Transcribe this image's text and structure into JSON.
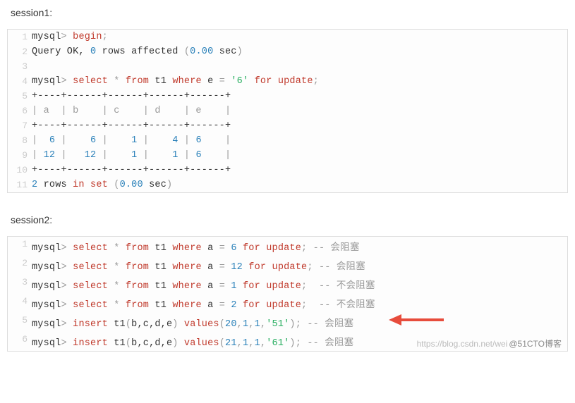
{
  "session1_label": "session1:",
  "session2_label": "session2:",
  "watermark1": "https://blog.csdn.net/wei",
  "watermark2": "@51CTO博客",
  "s1": {
    "l1": {
      "p1": "mysql",
      "p2": ">",
      "p3": " ",
      "p4": "begin",
      "p5": ";"
    },
    "l2": {
      "p1": "Query OK, ",
      "p2": "0",
      "p3": " rows affected ",
      "p4": "(",
      "p5": "0.00",
      "p6": " sec",
      "p7": ")"
    },
    "l4": {
      "p1": "mysql",
      "p2": ">",
      "p3": " ",
      "p4": "select",
      "p5": " ",
      "p6": "*",
      "p7": " ",
      "p8": "from",
      "p9": " t1 ",
      "p10": "where",
      "p11": " e ",
      "p12": "=",
      "p13": " ",
      "p14": "'6'",
      "p15": " ",
      "p16": "for",
      "p17": " ",
      "p18": "update",
      "p19": ";"
    },
    "l5": "+----+------+------+------+------+",
    "l6": "| a  | b    | c    | d    | e    |",
    "l7": "+----+------+------+------+------+",
    "l8": {
      "p0": "|  ",
      "a": "6",
      "p1": " |    ",
      "b": "6",
      "p2": " |    ",
      "c": "1",
      "p3": " |    ",
      "d": "4",
      "p4": " | ",
      "e": "6",
      "p5": "    |"
    },
    "l9": {
      "p0": "| ",
      "a": "12",
      "p1": " |   ",
      "b": "12",
      "p2": " |    ",
      "c": "1",
      "p3": " |    ",
      "d": "1",
      "p4": " | ",
      "e": "6",
      "p5": "    |"
    },
    "l10": "+----+------+------+------+------+",
    "l11": {
      "p1": "2",
      "p2": " rows ",
      "p3": "in",
      "p4": " ",
      "p5": "set",
      "p6": " ",
      "p7": "(",
      "p8": "0.00",
      "p9": " sec",
      "p10": ")"
    }
  },
  "s2": {
    "l1": {
      "p": "mysql",
      "gt": ">",
      "sp": " ",
      "sel": "select",
      "sp2": " ",
      "st": "*",
      "sp3": " ",
      "fr": "from",
      "sp4": " t1 ",
      "wh": "where",
      "sp5": " a ",
      "eq": "=",
      "sp6": " ",
      "n": "6",
      "sp7": " ",
      "fo": "for",
      "sp8": " ",
      "up": "update",
      "se": ";",
      "cm": " -- 会阻塞"
    },
    "l2": {
      "p": "mysql",
      "gt": ">",
      "sp": " ",
      "sel": "select",
      "sp2": " ",
      "st": "*",
      "sp3": " ",
      "fr": "from",
      "sp4": " t1 ",
      "wh": "where",
      "sp5": " a ",
      "eq": "=",
      "sp6": " ",
      "n": "12",
      "sp7": " ",
      "fo": "for",
      "sp8": " ",
      "up": "update",
      "se": ";",
      "cm": " -- 会阻塞"
    },
    "l3": {
      "p": "mysql",
      "gt": ">",
      "sp": " ",
      "sel": "select",
      "sp2": " ",
      "st": "*",
      "sp3": " ",
      "fr": "from",
      "sp4": " t1 ",
      "wh": "where",
      "sp5": " a ",
      "eq": "=",
      "sp6": " ",
      "n": "1",
      "sp7": " ",
      "fo": "for",
      "sp8": " ",
      "up": "update",
      "se": "; ",
      "cm": " -- 不会阻塞"
    },
    "l4": {
      "p": "mysql",
      "gt": ">",
      "sp": " ",
      "sel": "select",
      "sp2": " ",
      "st": "*",
      "sp3": " ",
      "fr": "from",
      "sp4": " t1 ",
      "wh": "where",
      "sp5": " a ",
      "eq": "=",
      "sp6": " ",
      "n": "2",
      "sp7": " ",
      "fo": "for",
      "sp8": " ",
      "up": "update",
      "se": "; ",
      "cm": " -- 不会阻塞"
    },
    "l5": {
      "p": "mysql",
      "gt": ">",
      "sp": " ",
      "ins": "insert",
      "sp2": " t1",
      "op": "(",
      "cols": "b,c,d,e",
      "cp": ")",
      "sp3": " ",
      "vl": "values",
      "op2": "(",
      "n1": "20",
      "c1": ",",
      "n2": "1",
      "c2": ",",
      "n3": "1",
      "c3": ",",
      "s": "'51'",
      "cp2": ")",
      "se": ";",
      "cm": " -- 会阻塞"
    },
    "l6": {
      "p": "mysql",
      "gt": ">",
      "sp": " ",
      "ins": "insert",
      "sp2": " t1",
      "op": "(",
      "cols": "b,c,d,e",
      "cp": ")",
      "sp3": " ",
      "vl": "values",
      "op2": "(",
      "n1": "21",
      "c1": ",",
      "n2": "1",
      "c2": ",",
      "n3": "1",
      "c3": ",",
      "s": "'61'",
      "cp2": ")",
      "se": ";",
      "cm": " -- 会阻塞"
    }
  }
}
